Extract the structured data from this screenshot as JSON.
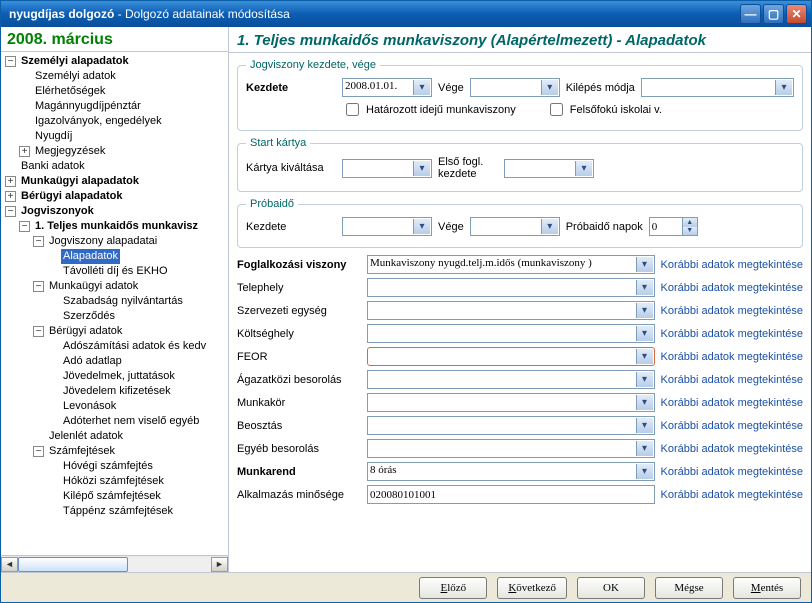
{
  "window": {
    "title_prefix": "nyugdíjas dolgozó",
    "title_suffix": "Dolgozó adatainak módosítása"
  },
  "date_header": "2008. március",
  "tree": {
    "n1": "Személyi alapadatok",
    "n1_1": "Személyi adatok",
    "n1_2": "Elérhetőségek",
    "n1_3": "Magánnyugdíjpénztár",
    "n1_4": "Igazolványok, engedélyek",
    "n1_5": "Nyugdíj",
    "n1_6": "Megjegyzések",
    "n2": "Banki adatok",
    "n3": "Munkaügyi alapadatok",
    "n4": "Bérügyi alapadatok",
    "n5": "Jogviszonyok",
    "n5_1": "1. Teljes munkaidős munkavisz",
    "n5_1_1": "Jogviszony alapadatai",
    "n5_1_1_1": "Alapadatok",
    "n5_1_1_2": "Távolléti díj és EKHO",
    "n5_1_2": "Munkaügyi adatok",
    "n5_1_2_1": "Szabadság nyilvántartás",
    "n5_1_2_2": "Szerződés",
    "n5_1_3": "Bérügyi adatok",
    "n5_1_3_1": "Adószámítási adatok és kedv",
    "n5_1_3_2": "Adó adatlap",
    "n5_1_3_3": "Jövedelmek, juttatások",
    "n5_1_3_4": "Jövedelem kifizetések",
    "n5_1_3_5": "Levonások",
    "n5_1_3_6": "Adóterhet nem viselő egyéb",
    "n5_1_4": "Jelenlét adatok",
    "n5_1_5": "Számfejtések",
    "n5_1_5_1": "Hóvégi számfejtés",
    "n5_1_5_2": "Hóközi számfejtések",
    "n5_1_5_3": "Kilépő számfejtések",
    "n5_1_5_4": "Táppénz számfejtések"
  },
  "right_header": "1. Teljes munkaidős munkaviszony (Alapértelmezett) - Alapadatok",
  "groups": {
    "g1_legend": "Jogviszony kezdete, vége",
    "g2_legend": "Start kártya",
    "g3_legend": "Próbaidő"
  },
  "labels": {
    "kezdete": "Kezdete",
    "vege": "Vége",
    "kilepes": "Kilépés módja",
    "hatarozott": "Határozott idejű munkaviszony",
    "felsofoku": "Felsőfokú iskolai v.",
    "kartya": "Kártya kiváltása",
    "elsofogl": "Első fogl. kezdete",
    "probanapok": "Próbaidő napok",
    "foglviszony": "Foglalkozási viszony",
    "telephely": "Telephely",
    "szervezeti": "Szervezeti egység",
    "koltseghely": "Költséghely",
    "feor": "FEOR",
    "agazatkozi": "Ágazatközi besorolás",
    "munkakor": "Munkakör",
    "beosztas": "Beosztás",
    "egyeb": "Egyéb besorolás",
    "munkarend": "Munkarend",
    "alkalmazas": "Alkalmazás minősége"
  },
  "values": {
    "kezdete": "2008.01.01.",
    "probanapok": "0",
    "foglviszony": "Munkaviszony nyugd.telj.m.idős (munkaviszony )",
    "munkarend": "8 órás",
    "alkalmazas": "020080101001"
  },
  "link": "Korábbi adatok megtekintése",
  "buttons": {
    "elozo": "Előző",
    "kovetkezo": "Következő",
    "ok": "OK",
    "megse": "Mégse",
    "mentes": "Mentés"
  }
}
